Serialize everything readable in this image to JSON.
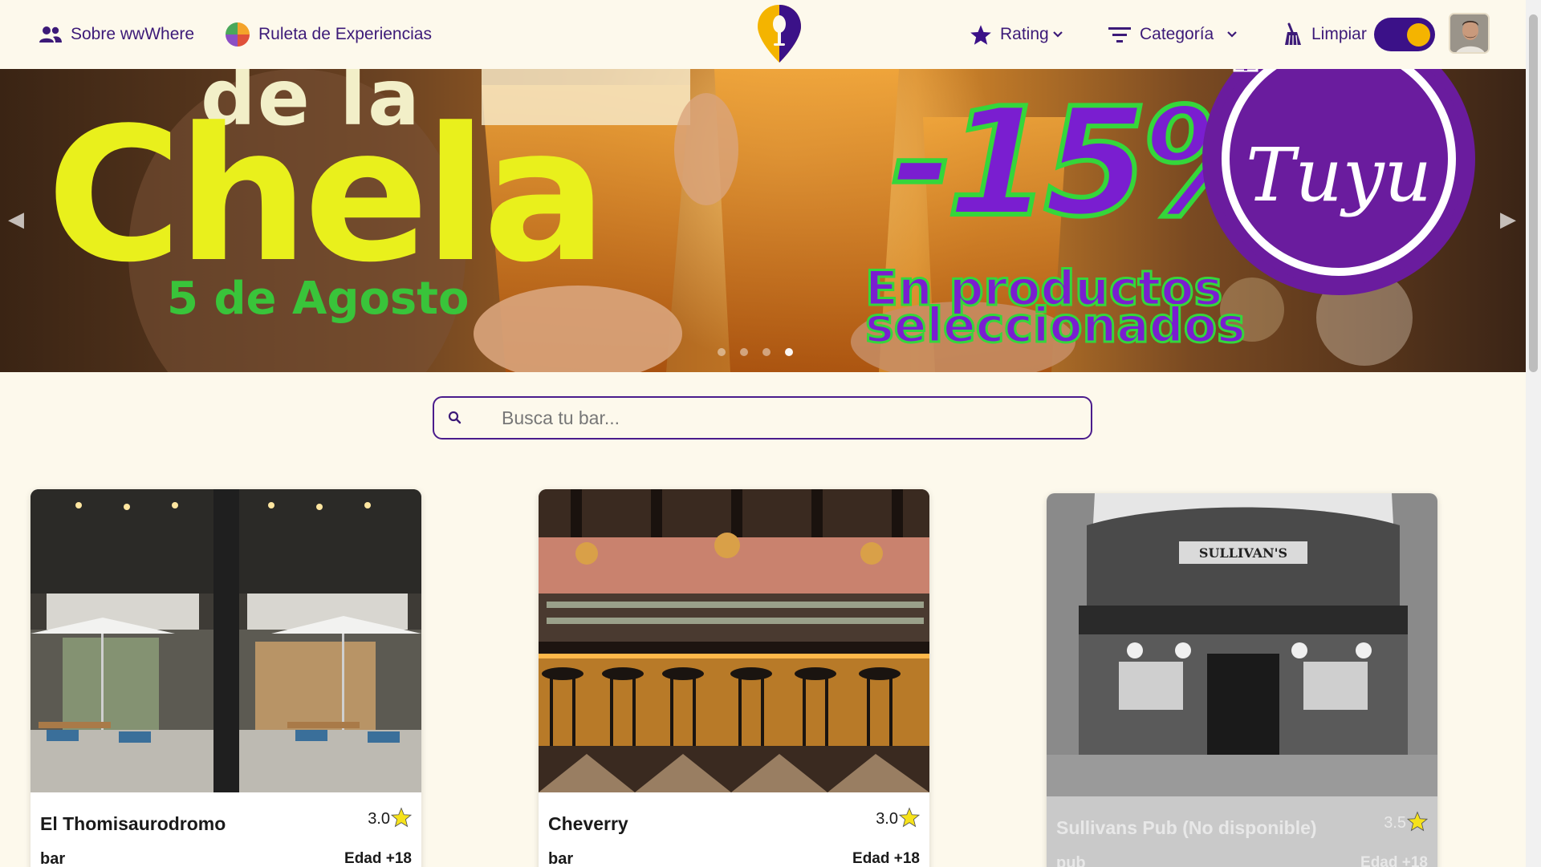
{
  "nav": {
    "about_label": "Sobre wwWhere",
    "roulette_label": "Ruleta de Experiencias",
    "rating_label": "Rating",
    "category_label": "Categoría",
    "clear_label": "Limpiar",
    "toggle_on": true,
    "accent_color": "#3b1188"
  },
  "hero": {
    "text_top": "de la",
    "text_main": "Chela",
    "text_date": "5 de Agosto",
    "discount": "-15%",
    "promo_line1": "En productos",
    "promo_line2": "seleccionados",
    "brand": "Tuyu",
    "slides": 3,
    "active_slide": 3
  },
  "search": {
    "placeholder": "Busca tu bar..."
  },
  "cards": [
    {
      "name": "El Thomisaurodromo",
      "rating": "3.0",
      "category": "bar",
      "age": "Edad +18",
      "available": true
    },
    {
      "name": "Cheverry",
      "rating": "3.0",
      "category": "bar",
      "age": "Edad +18",
      "available": true
    },
    {
      "name": "Sullivans Pub (No disponible)",
      "rating": "3.5",
      "category": "pub",
      "age": "Edad +18",
      "available": false,
      "sign_text": "SULLIVAN'S"
    }
  ]
}
